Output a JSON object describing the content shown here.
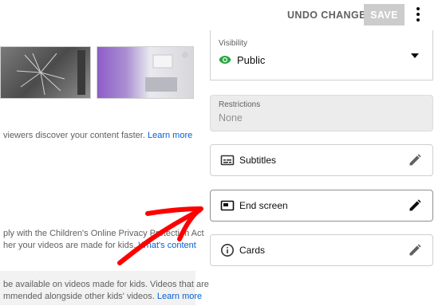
{
  "toolbar": {
    "undo_label": "UNDO CHANGES",
    "save_label": "SAVE",
    "more_icon": "kebab-icon"
  },
  "left": {
    "line1_text": "viewers discover your content faster.",
    "line1_link": "Learn more",
    "line2_text": "ply with the Children's Online Privacy Protection Act",
    "line3_text": "her your videos are made for kids.",
    "line3_link": "What's content",
    "note_line1": "be available on videos made for kids. Videos that are",
    "note_line2_text": "mmended alongside other kids' videos.",
    "note_line2_link": "Learn more"
  },
  "visibility": {
    "label": "Visibility",
    "value": "Public",
    "icon": "eye-icon"
  },
  "restrictions": {
    "label": "Restrictions",
    "value": "None"
  },
  "options": [
    {
      "label": "Subtitles",
      "icon": "subtitles-icon"
    },
    {
      "label": "End screen",
      "icon": "end-screen-icon"
    },
    {
      "label": "Cards",
      "icon": "info-icon"
    }
  ],
  "colors": {
    "accent_green": "#2ba640",
    "link_blue": "#065fd4",
    "arrow_red": "#ff0000"
  }
}
